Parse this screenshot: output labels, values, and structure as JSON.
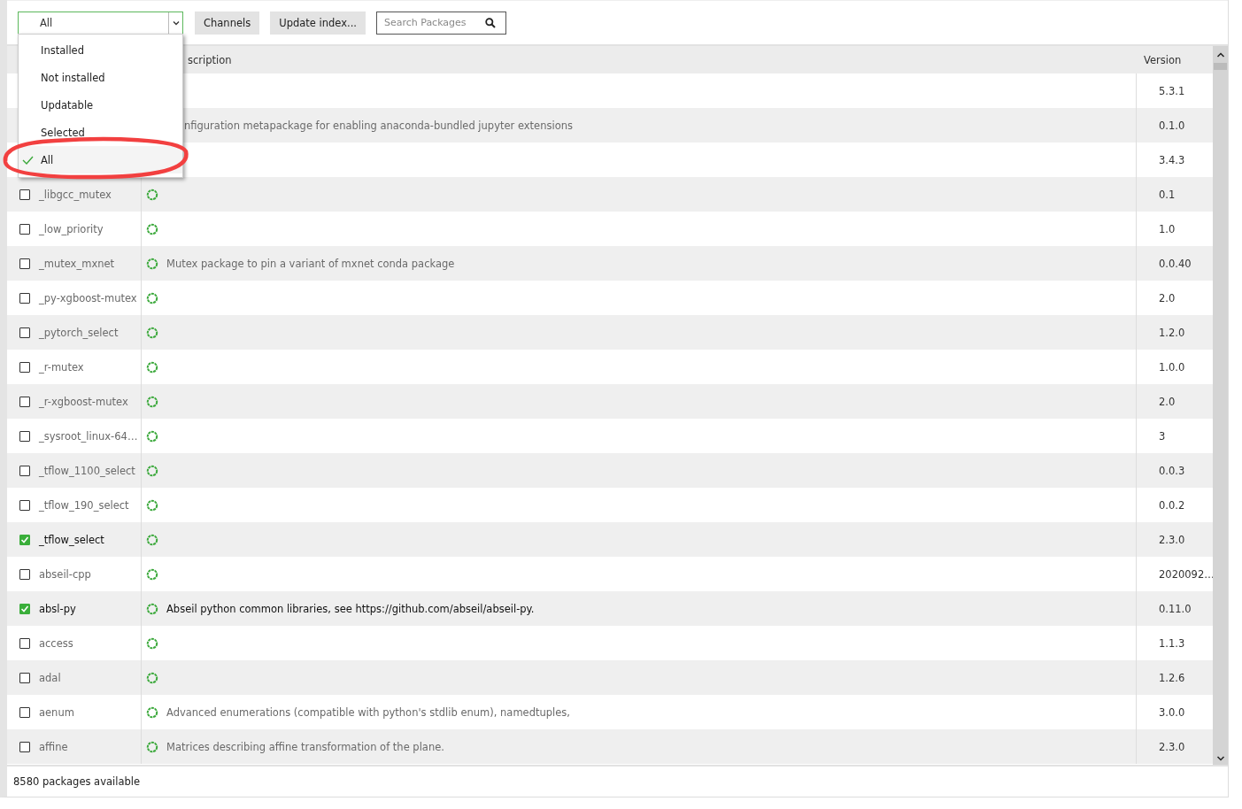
{
  "toolbar": {
    "filter": {
      "value": "All",
      "expanded": true,
      "options": [
        {
          "label": "Installed",
          "selected": false
        },
        {
          "label": "Not installed",
          "selected": false
        },
        {
          "label": "Updatable",
          "selected": false
        },
        {
          "label": "Selected",
          "selected": false
        },
        {
          "label": "All",
          "selected": true
        }
      ]
    },
    "buttons": [
      "Channels",
      "Update index..."
    ],
    "search": {
      "placeholder": "Search Packages"
    }
  },
  "table": {
    "columns": [
      "scription",
      "Version"
    ],
    "rows": [
      {
        "version": "5.3.1"
      },
      {
        "description": "nfiguration metapackage for enabling anaconda-bundled jupyter extensions",
        "version": "0.1.0"
      },
      {
        "version": "3.4.3"
      },
      {
        "name": "_libgcc_mutex",
        "checked": false,
        "version": "0.1"
      },
      {
        "name": "_low_priority",
        "checked": false,
        "version": "1.0"
      },
      {
        "name": "_mutex_mxnet",
        "checked": false,
        "description": "Mutex package to pin a variant of mxnet conda package",
        "version": "0.0.40"
      },
      {
        "name": "_py-xgboost-mutex",
        "checked": false,
        "version": "2.0"
      },
      {
        "name": "_pytorch_select",
        "checked": false,
        "version": "1.2.0"
      },
      {
        "name": "_r-mutex",
        "checked": false,
        "version": "1.0.0"
      },
      {
        "name": "_r-xgboost-mutex",
        "checked": false,
        "version": "2.0"
      },
      {
        "name": "_sysroot_linux-64…",
        "checked": false,
        "version": "3"
      },
      {
        "name": "_tflow_1100_select",
        "checked": false,
        "version": "0.0.3"
      },
      {
        "name": "_tflow_190_select",
        "checked": false,
        "version": "0.0.2"
      },
      {
        "name": "_tflow_select",
        "checked": true,
        "version": "2.3.0"
      },
      {
        "name": "abseil-cpp",
        "checked": false,
        "version": "2020092…"
      },
      {
        "name": "absl-py",
        "checked": true,
        "description": "Abseil python common libraries, see https://github.com/abseil/abseil-py.",
        "version": "0.11.0"
      },
      {
        "name": "access",
        "checked": false,
        "version": "1.1.3"
      },
      {
        "name": "adal",
        "checked": false,
        "version": "1.2.6"
      },
      {
        "name": "aenum",
        "checked": false,
        "description": "Advanced enumerations (compatible with python's stdlib enum), namedtuples,",
        "version": "3.0.0"
      },
      {
        "name": "affine",
        "checked": false,
        "description": "Matrices describing affine transformation of the plane.",
        "version": "2.3.0"
      }
    ]
  },
  "status_bar": "8580 packages available"
}
